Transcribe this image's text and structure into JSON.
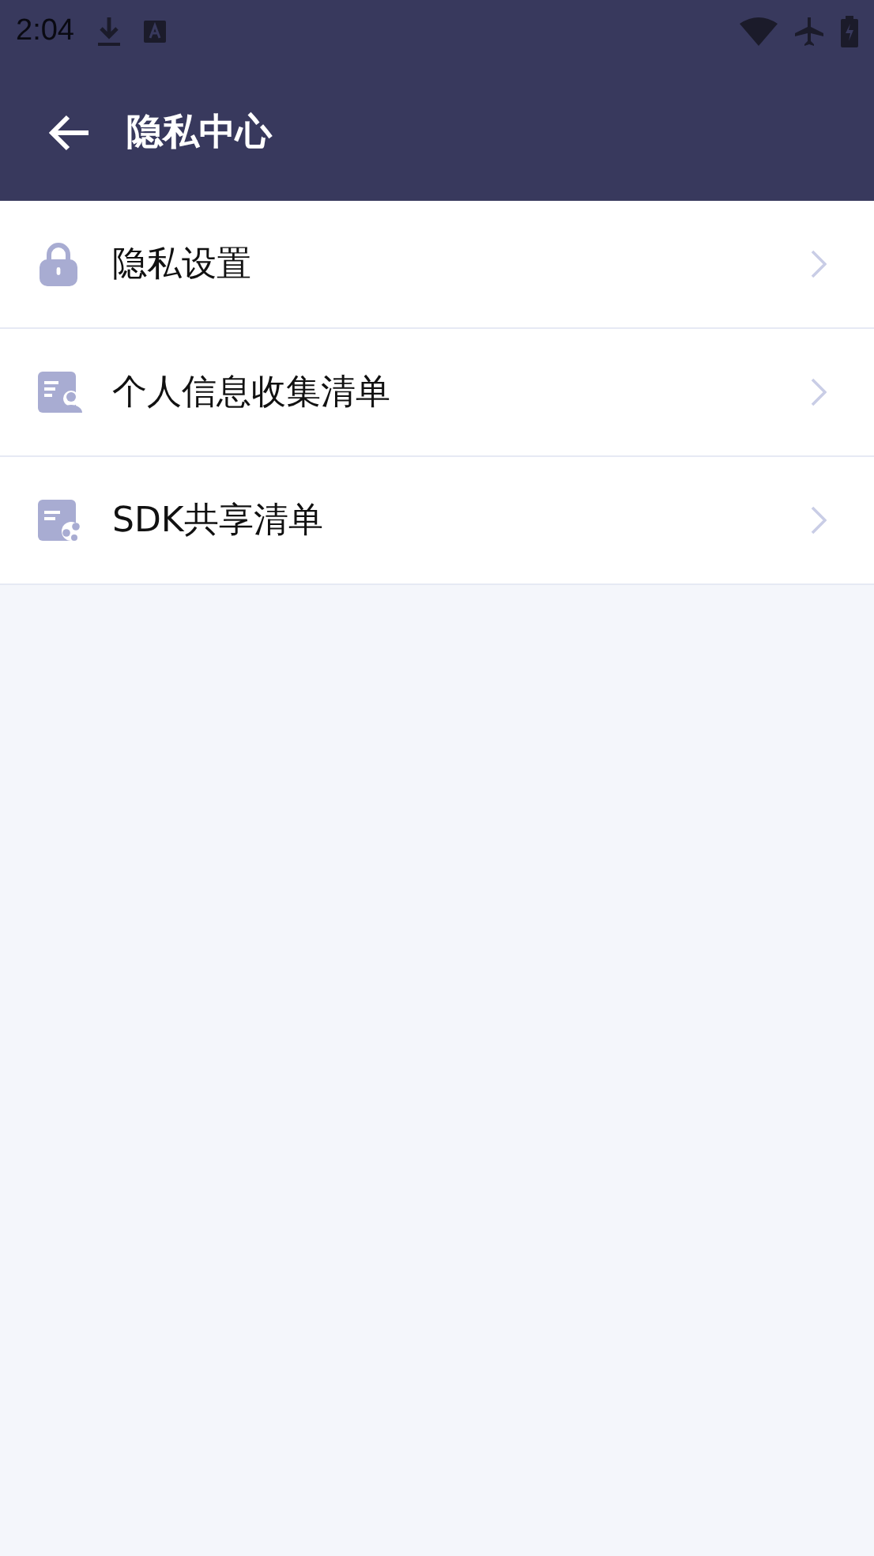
{
  "status_bar": {
    "time": "2:04"
  },
  "header": {
    "title": "隐私中心"
  },
  "items": [
    {
      "kind": "lock",
      "label": "隐私设置"
    },
    {
      "kind": "person-doc",
      "label": "个人信息收集清单"
    },
    {
      "kind": "share-doc",
      "label": "SDK共享清单"
    }
  ]
}
